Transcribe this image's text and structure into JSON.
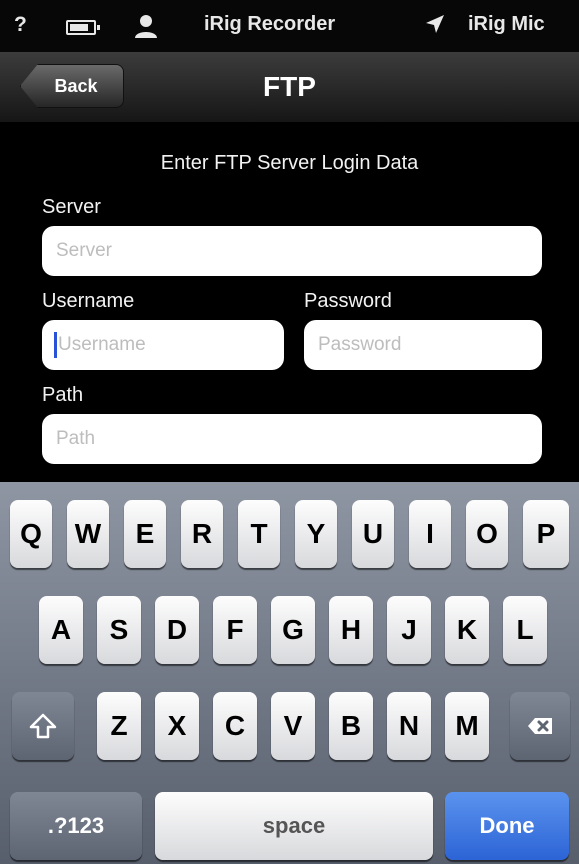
{
  "status_bar": {
    "help_glyph": "?",
    "battery_icon": "battery-icon",
    "person_icon": "person-icon",
    "app_name": "iRig Recorder",
    "location_arrow": "➤",
    "mic_name": "iRig Mic"
  },
  "nav": {
    "back_label": "Back",
    "title": "FTP"
  },
  "form": {
    "heading": "Enter FTP Server Login Data",
    "server_label": "Server",
    "server_placeholder": "Server",
    "username_label": "Username",
    "username_placeholder": "Username",
    "password_label": "Password",
    "password_placeholder": "Password",
    "path_label": "Path",
    "path_placeholder": "Path"
  },
  "keyboard": {
    "row1": [
      "Q",
      "W",
      "E",
      "R",
      "T",
      "Y",
      "U",
      "I",
      "O",
      "P"
    ],
    "row2": [
      "A",
      "S",
      "D",
      "F",
      "G",
      "H",
      "J",
      "K",
      "L"
    ],
    "row3": [
      "Z",
      "X",
      "C",
      "V",
      "B",
      "N",
      "M"
    ],
    "numbers_label": ".?123",
    "space_label": "space",
    "done_label": "Done"
  },
  "colors": {
    "accent_done": "#2d64d6",
    "cursor": "#2a52d8"
  }
}
